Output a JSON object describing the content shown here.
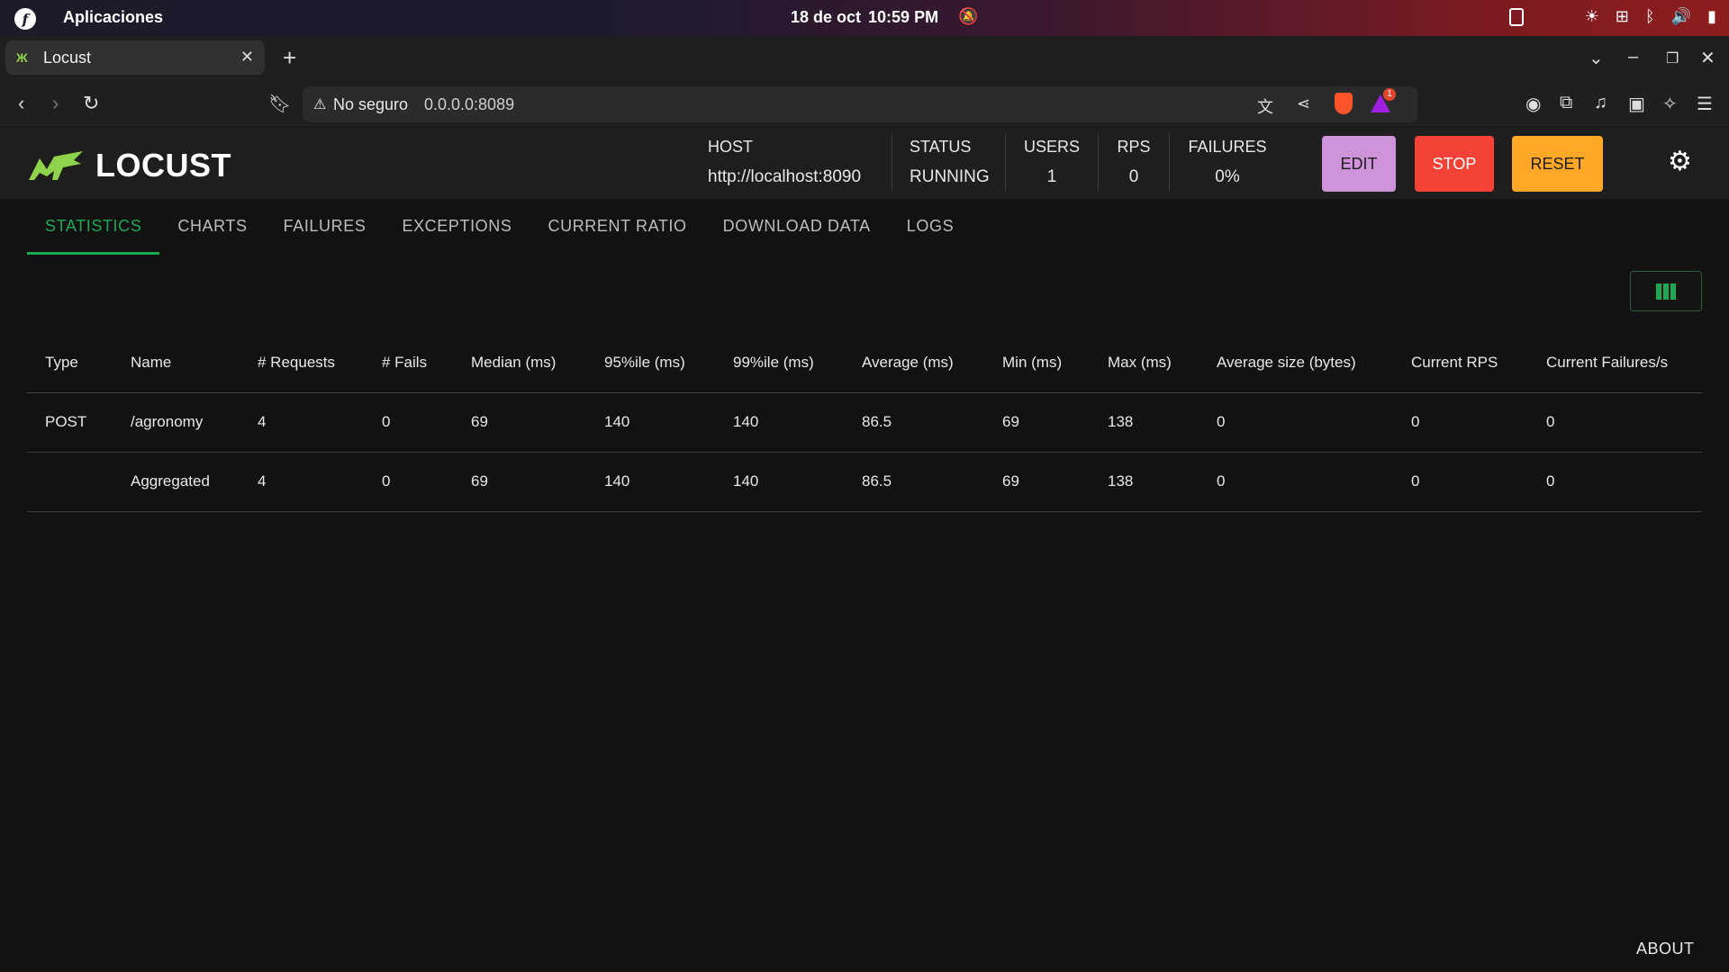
{
  "system_bar": {
    "apps_label": "Aplicaciones",
    "date": "18 de oct",
    "time": "10:59 PM"
  },
  "browser": {
    "tab_title": "Locust",
    "security_label": "No seguro",
    "url": "0.0.0.0:8089",
    "rewards_badge": "1"
  },
  "header": {
    "logo_text": "LOCUST",
    "host": {
      "label": "HOST",
      "value": "http://localhost:8090"
    },
    "status": {
      "label": "STATUS",
      "value": "RUNNING"
    },
    "users": {
      "label": "USERS",
      "value": "1"
    },
    "rps": {
      "label": "RPS",
      "value": "0"
    },
    "failures": {
      "label": "FAILURES",
      "value": "0%"
    },
    "edit_label": "EDIT",
    "stop_label": "STOP",
    "reset_label": "RESET"
  },
  "tabs": [
    {
      "label": "STATISTICS",
      "active": true
    },
    {
      "label": "CHARTS"
    },
    {
      "label": "FAILURES"
    },
    {
      "label": "EXCEPTIONS"
    },
    {
      "label": "CURRENT RATIO"
    },
    {
      "label": "DOWNLOAD DATA"
    },
    {
      "label": "LOGS"
    }
  ],
  "table": {
    "columns": [
      "Type",
      "Name",
      "# Requests",
      "# Fails",
      "Median (ms)",
      "95%ile (ms)",
      "99%ile (ms)",
      "Average (ms)",
      "Min (ms)",
      "Max (ms)",
      "Average size (bytes)",
      "Current RPS",
      "Current Failures/s"
    ],
    "rows": [
      [
        "POST",
        "/agronomy",
        "4",
        "0",
        "69",
        "140",
        "140",
        "86.5",
        "69",
        "138",
        "0",
        "0",
        "0"
      ],
      [
        "",
        "Aggregated",
        "4",
        "0",
        "69",
        "140",
        "140",
        "86.5",
        "69",
        "138",
        "0",
        "0",
        "0"
      ]
    ]
  },
  "footer": {
    "about_label": "ABOUT"
  },
  "colors": {
    "accent": "#1fa854",
    "edit": "#ce93d8",
    "stop": "#f44336",
    "reset": "#ffa726"
  }
}
